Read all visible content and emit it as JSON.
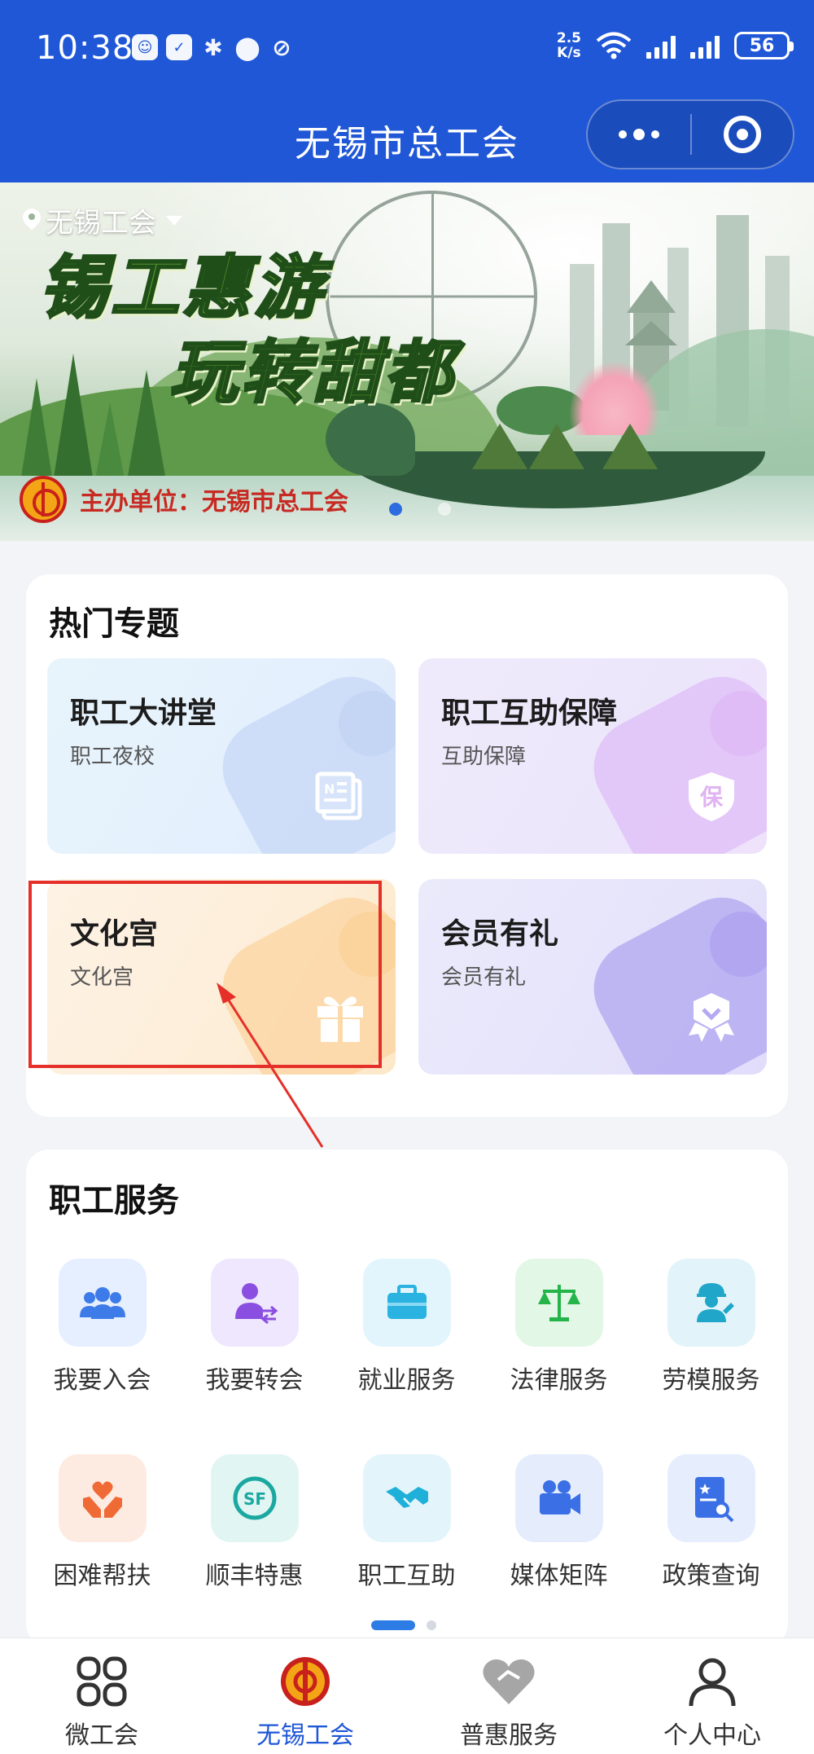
{
  "status_bar": {
    "time": "10:38",
    "net_speed_value": "2.5",
    "net_speed_unit": "K/s",
    "battery": "56"
  },
  "nav": {
    "title": "无锡市总工会"
  },
  "banner": {
    "location": "无锡工会",
    "headline_1": "锡工惠游",
    "headline_2": "玩转甜都",
    "organizer": "主办单位：无锡市总工会",
    "slide_count": 2,
    "active_slide": 1
  },
  "hot_topics": {
    "title": "热门专题",
    "tiles": [
      {
        "title": "职工大讲堂",
        "subtitle": "职工夜校",
        "icon": "newspaper-icon"
      },
      {
        "title": "职工互助保障",
        "subtitle": "互助保障",
        "icon": "shield-bao-icon",
        "icon_char": "保"
      },
      {
        "title": "文化宫",
        "subtitle": "文化宫",
        "icon": "gift-icon"
      },
      {
        "title": "会员有礼",
        "subtitle": "会员有礼",
        "icon": "badge-ribbon-icon"
      }
    ]
  },
  "services": {
    "title": "职工服务",
    "items": [
      {
        "label": "我要入会",
        "icon": "people-group-icon",
        "color": "#3d7ce8",
        "bg": "#e6efff"
      },
      {
        "label": "我要转会",
        "icon": "user-transfer-icon",
        "color": "#8a4fe0",
        "bg": "#efe7fd"
      },
      {
        "label": "就业服务",
        "icon": "briefcase-icon",
        "color": "#2ab2e0",
        "bg": "#e3f5fc"
      },
      {
        "label": "法律服务",
        "icon": "scales-icon",
        "color": "#25b44a",
        "bg": "#e3f7e7"
      },
      {
        "label": "劳模服务",
        "icon": "worker-icon",
        "color": "#1fa6c9",
        "bg": "#e2f4f9"
      },
      {
        "label": "困难帮扶",
        "icon": "heart-hands-icon",
        "color": "#f06a35",
        "bg": "#fdebe2"
      },
      {
        "label": "顺丰特惠",
        "icon": "sf-logo-icon",
        "color": "#1aa8a0",
        "bg": "#e1f5f3",
        "icon_text": "SF"
      },
      {
        "label": "职工互助",
        "icon": "handshake-icon",
        "color": "#1fb0d9",
        "bg": "#e3f5fb"
      },
      {
        "label": "媒体矩阵",
        "icon": "video-camera-icon",
        "color": "#3a6fe6",
        "bg": "#e5edfd"
      },
      {
        "label": "政策查询",
        "icon": "document-search-icon",
        "color": "#3a6fe6",
        "bg": "#e6eefd"
      }
    ],
    "page_count": 2,
    "active_page": 1
  },
  "tabbar": {
    "tabs": [
      {
        "label": "微工会",
        "icon": "grid-icon",
        "active": false
      },
      {
        "label": "无锡工会",
        "icon": "union-emblem-icon",
        "active": true
      },
      {
        "label": "普惠服务",
        "icon": "heart-icon",
        "active": false
      },
      {
        "label": "个人中心",
        "icon": "person-icon",
        "active": false
      }
    ]
  },
  "colors": {
    "header_blue": "#1f57d6",
    "highlight_red": "#e5302a",
    "active_tab": "#1f57d6"
  }
}
